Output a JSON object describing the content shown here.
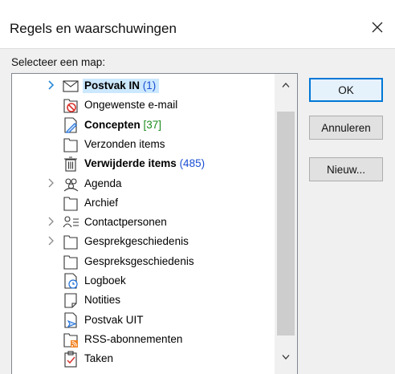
{
  "dialog": {
    "title": "Regels en waarschuwingen",
    "prompt": "Selecteer een map:"
  },
  "folders": [
    {
      "label": "Postvak IN",
      "count": "(1)",
      "icon": "inbox-icon",
      "bold": true,
      "selected": true,
      "expandable": true
    },
    {
      "label": "Ongewenste e-mail",
      "count": "",
      "icon": "junk-email-icon",
      "bold": false,
      "selected": false,
      "expandable": false
    },
    {
      "label": "Concepten",
      "count": "[37]",
      "icon": "drafts-icon",
      "bold": true,
      "selected": false,
      "expandable": false
    },
    {
      "label": "Verzonden items",
      "count": "",
      "icon": "folder-icon",
      "bold": false,
      "selected": false,
      "expandable": false
    },
    {
      "label": "Verwijderde items",
      "count": "(485)",
      "icon": "trash-icon",
      "bold": true,
      "selected": false,
      "expandable": false
    },
    {
      "label": "Agenda",
      "count": "",
      "icon": "calendar-people-icon",
      "bold": false,
      "selected": false,
      "expandable": true
    },
    {
      "label": "Archief",
      "count": "",
      "icon": "folder-icon",
      "bold": false,
      "selected": false,
      "expandable": false
    },
    {
      "label": "Contactpersonen",
      "count": "",
      "icon": "contacts-icon",
      "bold": false,
      "selected": false,
      "expandable": true
    },
    {
      "label": "Gesprekgeschiedenis",
      "count": "",
      "icon": "folder-icon",
      "bold": false,
      "selected": false,
      "expandable": true
    },
    {
      "label": "Gespreksgeschiedenis",
      "count": "",
      "icon": "folder-icon",
      "bold": false,
      "selected": false,
      "expandable": false
    },
    {
      "label": "Logboek",
      "count": "",
      "icon": "journal-icon",
      "bold": false,
      "selected": false,
      "expandable": false
    },
    {
      "label": "Notities",
      "count": "",
      "icon": "notes-icon",
      "bold": false,
      "selected": false,
      "expandable": false
    },
    {
      "label": "Postvak UIT",
      "count": "",
      "icon": "outbox-icon",
      "bold": false,
      "selected": false,
      "expandable": false
    },
    {
      "label": "RSS-abonnementen",
      "count": "",
      "icon": "rss-icon",
      "bold": false,
      "selected": false,
      "expandable": false
    },
    {
      "label": "Taken",
      "count": "",
      "icon": "tasks-icon",
      "bold": false,
      "selected": false,
      "expandable": false
    }
  ],
  "buttons": {
    "ok": "OK",
    "cancel": "Annuleren",
    "new": "Nieuw..."
  },
  "colors": {
    "selection": "#cce8ff",
    "count_blue": "#1a4fd3",
    "count_green": "#1b8a1b",
    "default_button_border": "#0078d7"
  }
}
